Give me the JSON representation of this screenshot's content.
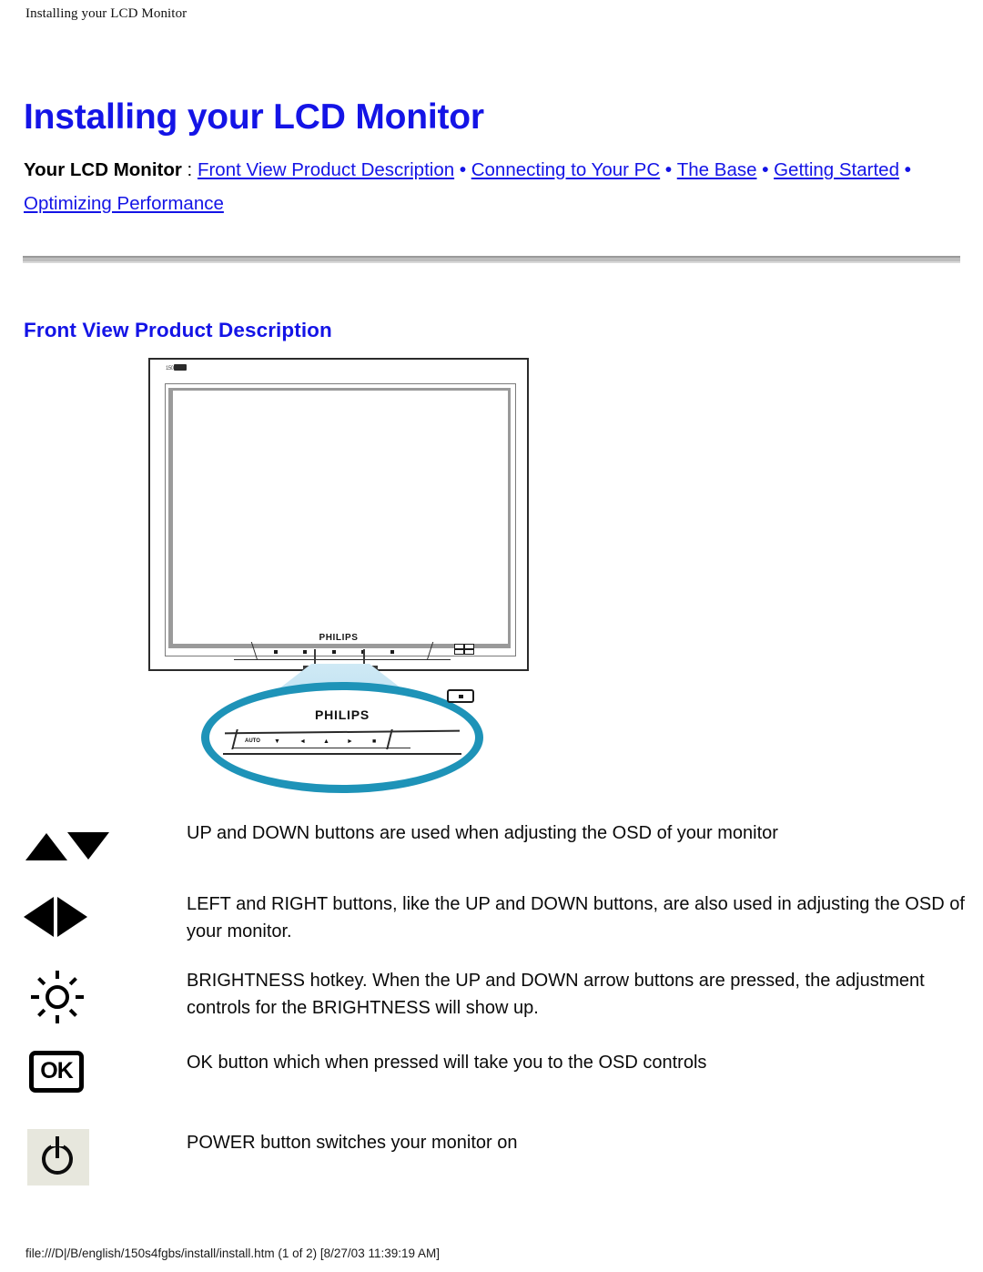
{
  "header": {
    "running_head": "Installing your LCD Monitor"
  },
  "title": {
    "main": "Installing your LCD Monitor"
  },
  "nav": {
    "lead": "Your LCD Monitor",
    "colon": " : ",
    "separator": "•",
    "links": [
      {
        "label": "Front View Product Description"
      },
      {
        "label": "Connecting to Your PC"
      },
      {
        "label": "The Base"
      },
      {
        "label": "Getting Started"
      },
      {
        "label": "Optimizing Performance"
      }
    ]
  },
  "section": {
    "heading": "Front View Product Description"
  },
  "figure": {
    "brand": "PHILIPS",
    "top_logo_text": "150",
    "callout_brand": "PHILIPS",
    "panel_glyphs": [
      "AUTO",
      "▼",
      "◄",
      "▲",
      "►",
      "■"
    ],
    "oval_color": "#1e93b8",
    "beam_color": "#bfe2f3"
  },
  "features": [
    {
      "icon": "up-down-arrows-icon",
      "text": "UP and DOWN buttons are used when adjusting the OSD of your monitor"
    },
    {
      "icon": "left-right-arrows-icon",
      "text": "LEFT and RIGHT buttons, like the UP and DOWN buttons, are also used in adjusting the OSD of your monitor."
    },
    {
      "icon": "brightness-icon",
      "text": "BRIGHTNESS hotkey. When the UP and DOWN arrow buttons are pressed, the adjustment controls for the BRIGHTNESS will show up."
    },
    {
      "icon": "ok-button-icon",
      "label": "OK",
      "text": "OK button which when pressed will take you to the OSD controls"
    },
    {
      "icon": "power-button-icon",
      "text": "POWER button switches your monitor on"
    }
  ],
  "footer": {
    "text": "file:///D|/B/english/150s4fgbs/install/install.htm (1 of 2) [8/27/03 11:39:19 AM]"
  },
  "colors": {
    "link_blue": "#1414e6",
    "heading_blue": "#1414e6",
    "oval_teal": "#1e93b8",
    "text_black": "#0a0a0a"
  }
}
